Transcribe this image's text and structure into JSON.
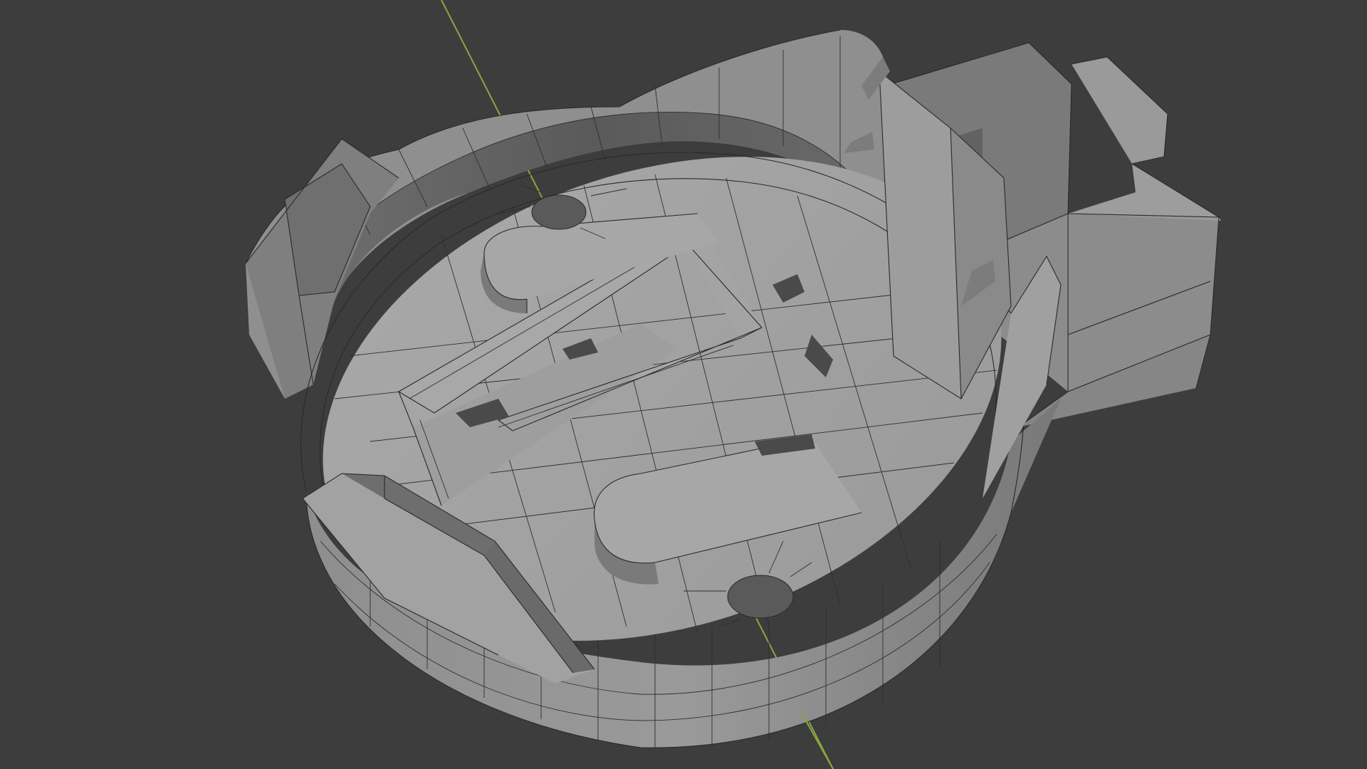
{
  "viewport": {
    "background": "#3d3d3d",
    "grid_color": "#3d3d3d",
    "axis_color": "#8aa640",
    "shading": "solid",
    "overlay": "wireframe"
  },
  "model": {
    "object": "coin-cell-battery-holder",
    "material_color": "#9c9c9c",
    "edge_color": "#2a2a2a"
  }
}
